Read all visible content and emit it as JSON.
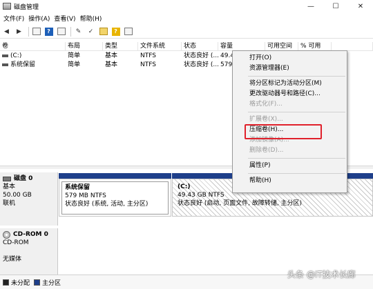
{
  "window": {
    "title": "磁盘管理",
    "controls": [
      "—",
      "☐",
      "✕"
    ]
  },
  "menu": [
    "文件(F)",
    "操作(A)",
    "查看(V)",
    "帮助(H)"
  ],
  "volume_table": {
    "headers": [
      "卷",
      "布局",
      "类型",
      "文件系统",
      "状态",
      "容量",
      "可用空间",
      "% 可用"
    ],
    "rows": [
      [
        "(C:)",
        "简单",
        "基本",
        "NTFS",
        "状态良好 (...",
        "49.4",
        "",
        ""
      ],
      [
        "系统保留",
        "简单",
        "基本",
        "NTFS",
        "状态良好 (...",
        "579",
        "",
        ""
      ]
    ]
  },
  "disks": [
    {
      "name": "磁盘 0",
      "type": "基本",
      "size": "50.00 GB",
      "status": "联机",
      "partitions": [
        {
          "name": "系统保留",
          "size": "579 MB NTFS",
          "status": "状态良好 (系统, 活动, 主分区)"
        },
        {
          "name": "(C:)",
          "size": "49.43 GB NTFS",
          "status": "状态良好 (启动, 页面文件, 故障转储, 主分区)"
        }
      ]
    }
  ],
  "cdrom": {
    "name": "CD-ROM 0",
    "type": "CD-ROM",
    "status": "无媒体"
  },
  "legend": {
    "unallocated": "未分配",
    "primary": "主分区"
  },
  "context_menu": {
    "items": [
      {
        "label": "打开(O)",
        "enabled": true
      },
      {
        "label": "资源管理器(E)",
        "enabled": true
      },
      {
        "label": "将分区标记为活动分区(M)",
        "enabled": true
      },
      {
        "label": "更改驱动器号和路径(C)...",
        "enabled": true
      },
      {
        "label": "格式化(F)...",
        "enabled": false
      },
      {
        "label": "扩展卷(X)...",
        "enabled": false
      },
      {
        "label": "压缩卷(H)...",
        "enabled": true,
        "highlighted": true
      },
      {
        "label": "添加镜像(A)...",
        "enabled": false
      },
      {
        "label": "删除卷(D)...",
        "enabled": false
      },
      {
        "label": "属性(P)",
        "enabled": true
      },
      {
        "label": "帮助(H)",
        "enabled": true
      }
    ]
  },
  "watermark": "头条 @IT技术长廊",
  "colors": {
    "primary_partition": "#1e3f8a",
    "highlight_box": "#e0202a"
  }
}
